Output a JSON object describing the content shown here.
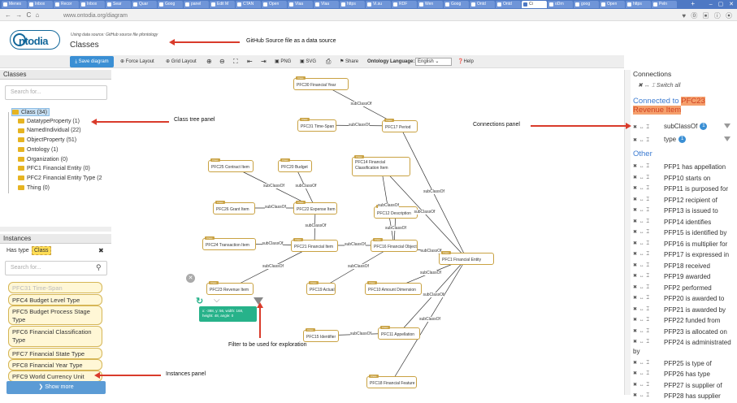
{
  "browser": {
    "tabs": [
      "Menes",
      "Inbox",
      "Recor",
      "Inbox",
      "Sear",
      "Quar",
      "Goog",
      "panel",
      "Edit M",
      "CTAN",
      "Open",
      "Vlaa",
      "Vlaa",
      "https",
      "Vi.su",
      "RDF",
      "Wen",
      "Goog",
      "Ontd",
      "Ontd",
      "Ci",
      "oDrn",
      "goog",
      "Open",
      "https",
      "Peln"
    ],
    "new_tab": "+",
    "window_controls": "– ▢ ✕",
    "nav": "← → C ⌂",
    "url": "www.ontodia.org/diagram",
    "ext_icons": "♥ ⓪ ▣ ⓘ ⦿"
  },
  "header": {
    "logo_text": "ntodia",
    "data_source": "Using data source: GitHub source file pfontology",
    "title": "Classes"
  },
  "toolbar": {
    "save": "⤓ Save diagram",
    "force_layout": "⊕ Force Layout",
    "grid_layout": "⊕ Grid Layout",
    "zoom_in": "⊕",
    "zoom_out": "⊖",
    "fit": "⛶",
    "undo": "⇤",
    "redo": "⇥",
    "png": "▣ PNG",
    "svg": "▣ SVG",
    "print": "⎙",
    "share": "⚑ Share",
    "lang_label": "Ontology Language:",
    "lang_value": "English",
    "help": "❓Help"
  },
  "classes_panel": {
    "title": "Classes",
    "search_placeholder": "Search for...",
    "items": [
      "Class (34)",
      "DatatypeProperty (1)",
      "NamedIndividual (22)",
      "ObjectProperty (51)",
      "Ontology (1)",
      "Organization (0)",
      "PFC1 Financial Entity (0)",
      "PFC2 Financial Entity Type (2",
      "Thing (0)"
    ]
  },
  "instances_panel": {
    "title": "Instances",
    "has_type_label": "Has type",
    "has_type_value": "Class",
    "search_placeholder": "Search for...",
    "items": [
      "PFC31 Time-Span",
      "PFC4 Budget Level Type",
      "PFC5 Budget Process Stage Type",
      "PFC6 Financial Classification Type",
      "PFC7 Financial State Type",
      "PFC8 Financial Year Type",
      "PFC9 World Currency Unit"
    ],
    "show_more": "❯ Show more"
  },
  "diagram": {
    "nodes": [
      {
        "id": "n30",
        "label": "PFC30 Financial Year"
      },
      {
        "id": "n31",
        "label": "PFC31 Time-Span"
      },
      {
        "id": "n17",
        "label": "PFC17 Period"
      },
      {
        "id": "n25",
        "label": "PFC25 Contract Item"
      },
      {
        "id": "n20",
        "label": "PFC20 Budget"
      },
      {
        "id": "n14",
        "label": "PFC14 Financial Classification Item"
      },
      {
        "id": "n26",
        "label": "PFC26 Grant Item"
      },
      {
        "id": "n22",
        "label": "PFC22 Expense Item"
      },
      {
        "id": "n12",
        "label": "PFC12 Description"
      },
      {
        "id": "n24",
        "label": "PFC24 Transaction Item"
      },
      {
        "id": "n21",
        "label": "PFC21 Financial Item"
      },
      {
        "id": "n16",
        "label": "PFC16 Financial Object"
      },
      {
        "id": "n1",
        "label": "PFC1 Financial Entity"
      },
      {
        "id": "n23",
        "label": "PFC23 Revenue Item"
      },
      {
        "id": "n19",
        "label": "PFC19 Actual"
      },
      {
        "id": "n10",
        "label": "PFC10 Amount Dimension"
      },
      {
        "id": "n15",
        "label": "PFC15 Identifier"
      },
      {
        "id": "n11",
        "label": "PFC11 Appellation"
      },
      {
        "id": "n18",
        "label": "PFC18 Financial Feature"
      }
    ],
    "node_type_badge": "Class",
    "edge_label": "subClassOf",
    "tooltip": "x: -388, y: 56, width: 168, height: 48, angle: 0",
    "refresh_icon": "↻",
    "chevron_icon": "⌵",
    "close_icon": "✕"
  },
  "connections_panel": {
    "title": "Connections",
    "switch_all": "✖ ↔ ⌶ Switch all",
    "connected_to_label": "Connected to",
    "connected_to_value": "PFC23 Revenue Item",
    "connected": [
      {
        "label": "subClassOf",
        "count": "1"
      },
      {
        "label": "type",
        "count": "1"
      }
    ],
    "other_title": "Other",
    "row_controls": "✖ ↔ ⌶",
    "other": [
      "PFP1 has appellation",
      "PFP10 starts on",
      "PFP11 is purposed for",
      "PFP12 recipient of",
      "PFP13 is issued to",
      "PFP14 identifies",
      "PFP15 is identified by",
      "PFP16 is multiplier for",
      "PFP17 is expressed in",
      "PFP18 received",
      "PFP19 awarded",
      "PFP2 performed",
      "PFP20 is awarded to",
      "PFP21 is awarded by",
      "PFP22 funded from",
      "PFP23 is allocated on",
      "PFP24 is administrated by",
      "PFP25 is type of",
      "PFP26 has type",
      "PFP27 is supplier of",
      "PFP28 has supplier"
    ]
  },
  "annotations": {
    "github": "GitHub Source file as a data source",
    "class_tree": "Class tree panel",
    "connections": "Connections panel",
    "filter": "Filter to be used for exploration",
    "instances": "Instances panel"
  },
  "colors": {
    "accent": "#3a8fd4",
    "node_border": "#c9a243",
    "annotation_arrow": "#d93b2b",
    "tooltip": "#27b28a"
  }
}
